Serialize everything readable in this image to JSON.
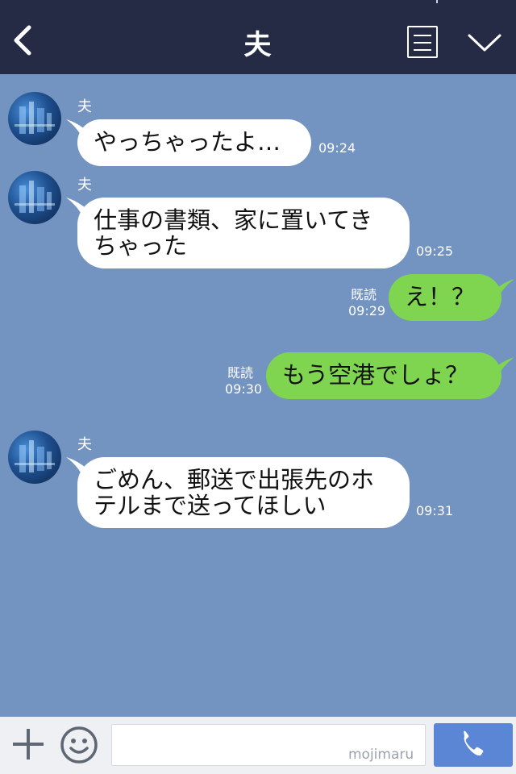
{
  "header": {
    "title": "夫",
    "back_icon": "chevron-left-icon",
    "menu_icon": "list-icon",
    "collapse_icon": "chevron-down-icon",
    "background": "#252b45"
  },
  "chat": {
    "background": "#7393c0",
    "messages": [
      {
        "side": "left",
        "sender": "夫",
        "lines": [
          "やっちゃったよ…"
        ],
        "time": "09:24"
      },
      {
        "side": "left",
        "sender": "夫",
        "lines": [
          "仕事の書類、家に置いてき",
          "ちゃった"
        ],
        "time": "09:25"
      },
      {
        "side": "right",
        "read": "既読",
        "lines": [
          "え！？"
        ],
        "time": "09:29"
      },
      {
        "side": "right",
        "read": "既読",
        "lines": [
          "もう空港でしょ？"
        ],
        "time": "09:30"
      },
      {
        "side": "left",
        "sender": "夫",
        "lines": [
          "ごめん、郵送で出張先のホ",
          "テルまで送ってほしい"
        ],
        "time": "09:31"
      }
    ],
    "bubble_colors": {
      "incoming": "#ffffff",
      "outgoing": "#7fd550"
    }
  },
  "composer": {
    "plus_icon": "plus-icon",
    "emoji_icon": "smiley-icon",
    "input_value": "",
    "watermark": "mojimaru",
    "call_icon": "phone-icon",
    "call_color": "#5b86d6"
  }
}
